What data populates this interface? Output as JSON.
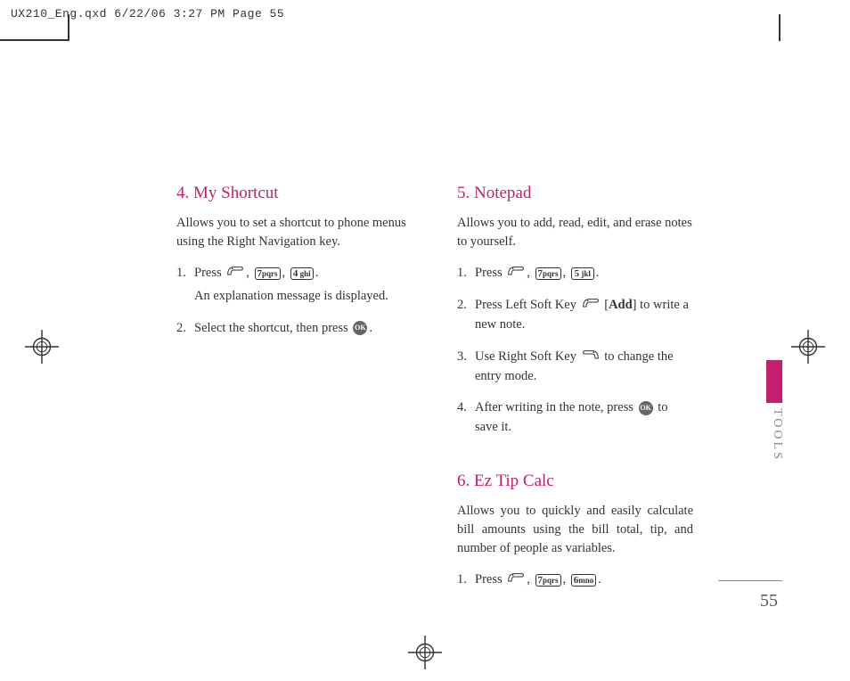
{
  "header": "UX210_Eng.qxd  6/22/06  3:27 PM  Page 55",
  "left_col": {
    "s1": {
      "heading": "4. My Shortcut",
      "desc": "Allows you to set a shortcut to phone menus using the Right Navigation key.",
      "step1_pre": "Press ",
      "step1_sub": "An explanation message is displayed.",
      "step2_pre": "Select the shortcut, then press ",
      "step2_post": "."
    }
  },
  "right_col": {
    "s1": {
      "heading": "5. Notepad",
      "desc": "Allows you to add, read, edit, and erase notes to yourself.",
      "step1_pre": "Press ",
      "step2_pre": "Press Left Soft Key ",
      "step2_mid": " [",
      "step2_add": "Add",
      "step2_post": "] to write a new note.",
      "step3_pre": "Use Right Soft Key ",
      "step3_post": " to change the entry mode.",
      "step4_pre": "After writing in the note, press ",
      "step4_post": " to save it."
    },
    "s2": {
      "heading": "6. Ez Tip Calc",
      "desc": "Allows you to quickly and easily calculate bill amounts using the bill total, tip, and number of people as variables.",
      "step1_pre": "Press "
    }
  },
  "keys": {
    "k7": "7pqrs",
    "k4": "4 ghi",
    "k5": "5 jkl",
    "k6": "6mno",
    "ok": "OK"
  },
  "side_label": "TOOLS",
  "page_num": "55"
}
